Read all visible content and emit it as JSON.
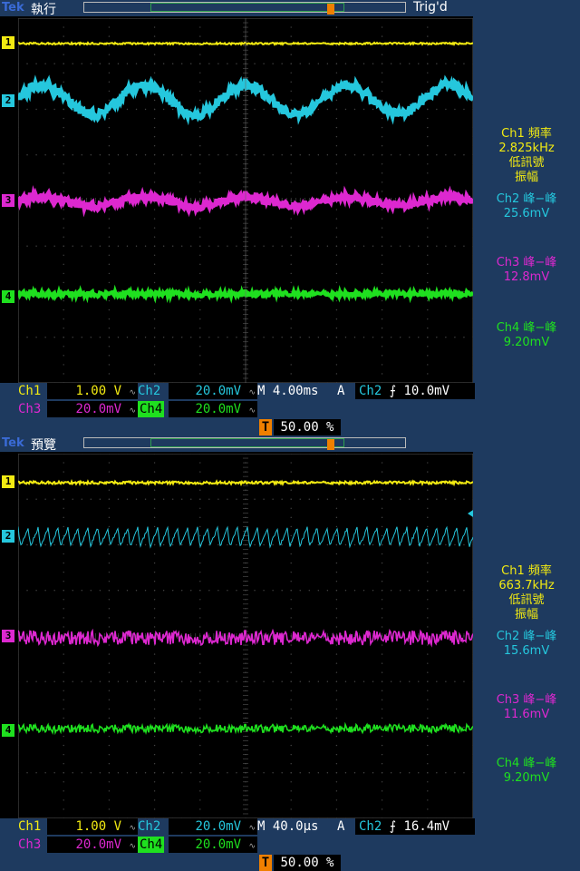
{
  "colors": {
    "ch1": "#f2ea12",
    "ch2": "#25c7dd",
    "ch3": "#dd28d0",
    "ch4": "#1fe01f",
    "trigger": "#f08000",
    "panel": "#1e3a5f"
  },
  "icons": {
    "trigger_marker": "T",
    "trigger_slope": "rising-edge-icon",
    "coupling": "bandwidth-limit-icon"
  },
  "screens": [
    {
      "logo": "Tek",
      "mode": "執行",
      "trigger_status": "Trig'd",
      "channel_markers": [
        "1",
        "2",
        "3",
        "4"
      ],
      "measurements": [
        {
          "title": "Ch1 頻率",
          "value": "2.825kHz",
          "note1": "低訊號",
          "note2": "振幅"
        },
        {
          "title": "Ch2 峰−峰",
          "value": "25.6mV"
        },
        {
          "title": "Ch3 峰−峰",
          "value": "12.8mV"
        },
        {
          "title": "Ch4 峰−峰",
          "value": "9.20mV"
        }
      ],
      "ch1_label": "Ch1",
      "ch1_scale": "1.00 V",
      "ch2_label": "Ch2",
      "ch2_scale": "20.0mV",
      "ch3_label": "Ch3",
      "ch3_scale": "20.0mV",
      "ch4_label": "Ch4",
      "ch4_scale": "20.0mV",
      "timebase": "M 4.00ms",
      "acq": "A",
      "trig_source": "Ch2",
      "trig_level": "10.0mV",
      "trig_pos": "50.00 %",
      "trigger_marker": "T"
    },
    {
      "logo": "Tek",
      "mode": "預覽",
      "trigger_status": "",
      "channel_markers": [
        "1",
        "2",
        "3",
        "4"
      ],
      "measurements": [
        {
          "title": "Ch1 頻率",
          "value": "663.7kHz",
          "note1": "低訊號",
          "note2": "振幅"
        },
        {
          "title": "Ch2 峰−峰",
          "value": "15.6mV"
        },
        {
          "title": "Ch3 峰−峰",
          "value": "11.6mV"
        },
        {
          "title": "Ch4 峰−峰",
          "value": "9.20mV"
        }
      ],
      "ch1_label": "Ch1",
      "ch1_scale": "1.00 V",
      "ch2_label": "Ch2",
      "ch2_scale": "20.0mV",
      "ch3_label": "Ch3",
      "ch3_scale": "20.0mV",
      "ch4_label": "Ch4",
      "ch4_scale": "20.0mV",
      "timebase": "M 40.0µs",
      "acq": "A",
      "trig_source": "Ch2",
      "trig_level": "16.4mV",
      "trig_pos": "50.00 %",
      "trigger_marker": "T"
    }
  ]
}
